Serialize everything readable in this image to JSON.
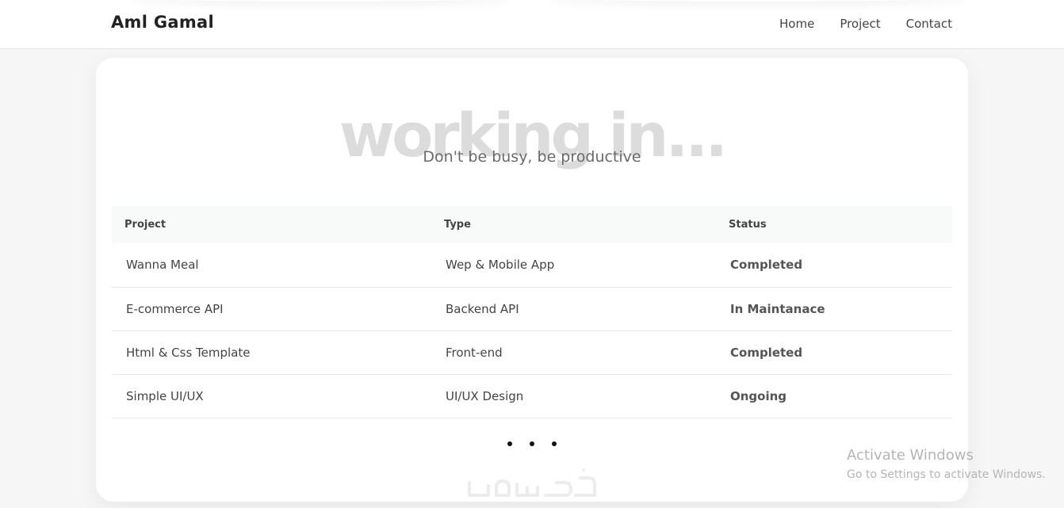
{
  "brand": "Aml Gamal",
  "nav": {
    "home": "Home",
    "project": "Project",
    "contact": "Contact"
  },
  "hero": {
    "background_text": "working in...",
    "subtitle": "Don't be busy, be productive"
  },
  "table": {
    "headers": [
      "Project",
      "Type",
      "Status"
    ],
    "rows": [
      {
        "project": "Wanna Meal",
        "type": "Wep & Mobile App",
        "status": "Completed"
      },
      {
        "project": "E-commerce API",
        "type": "Backend API",
        "status": "In Maintanace"
      },
      {
        "project": "Html & Css Template",
        "type": "Front-end",
        "status": "Completed"
      },
      {
        "project": "Simple UI/UX",
        "type": "UI/UX Design",
        "status": "Ongoing"
      }
    ]
  },
  "watermark": {
    "line1": "Activate Windows",
    "line2": "Go to Settings to activate Windows."
  },
  "colors": {
    "background": "#f6f6f7",
    "hero_text": "#dcdcdc",
    "card": "#ffffff"
  }
}
